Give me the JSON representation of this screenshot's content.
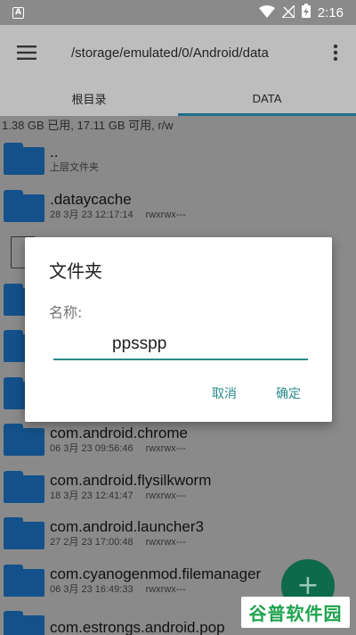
{
  "statusbar": {
    "time": "2:16"
  },
  "appbar": {
    "path": "/storage/emulated/0/Android/data"
  },
  "tabs": [
    {
      "label": "根目录",
      "active": false
    },
    {
      "label": "DATA",
      "active": true
    }
  ],
  "storage_info": "1.38 GB 已用, 17.11 GB 可用, r/w",
  "files": [
    {
      "name": "..",
      "date": "上层文件夹",
      "perm": ""
    },
    {
      "name": ".dataycache",
      "date": "28 3月 23 12:17:14",
      "perm": "rwxrwx---"
    },
    {
      "name": "",
      "date": "",
      "perm": ""
    },
    {
      "name": "",
      "date": "",
      "perm": ""
    },
    {
      "name": "",
      "date": "",
      "perm": ""
    },
    {
      "name": "",
      "date": "",
      "perm": ""
    },
    {
      "name": "com.android.chrome",
      "date": "06 3月 23 09:56:46",
      "perm": "rwxrwx---"
    },
    {
      "name": "com.android.flysilkworm",
      "date": "18 3月 23 12:41:47",
      "perm": "rwxrwx---"
    },
    {
      "name": "com.android.launcher3",
      "date": "27 2月 23 17:00:48",
      "perm": "rwxrwx---"
    },
    {
      "name": "com.cyanogenmod.filemanager",
      "date": "06 3月 23 16:49:33",
      "perm": "rwxrwx---"
    },
    {
      "name": "com.estrongs.android.pop",
      "date": "",
      "perm": ""
    }
  ],
  "dialog": {
    "title": "文件夹",
    "label": "名称:",
    "input_value": "ppsspp",
    "cancel_label": "取消",
    "ok_label": "确定"
  },
  "fab": {
    "symbol": "+"
  },
  "watermark": "谷普软件园",
  "colors": {
    "accent": "#2a8a8a",
    "folder": "#14518a",
    "fab": "#0e6a4a",
    "watermark": "#1ea34d"
  }
}
